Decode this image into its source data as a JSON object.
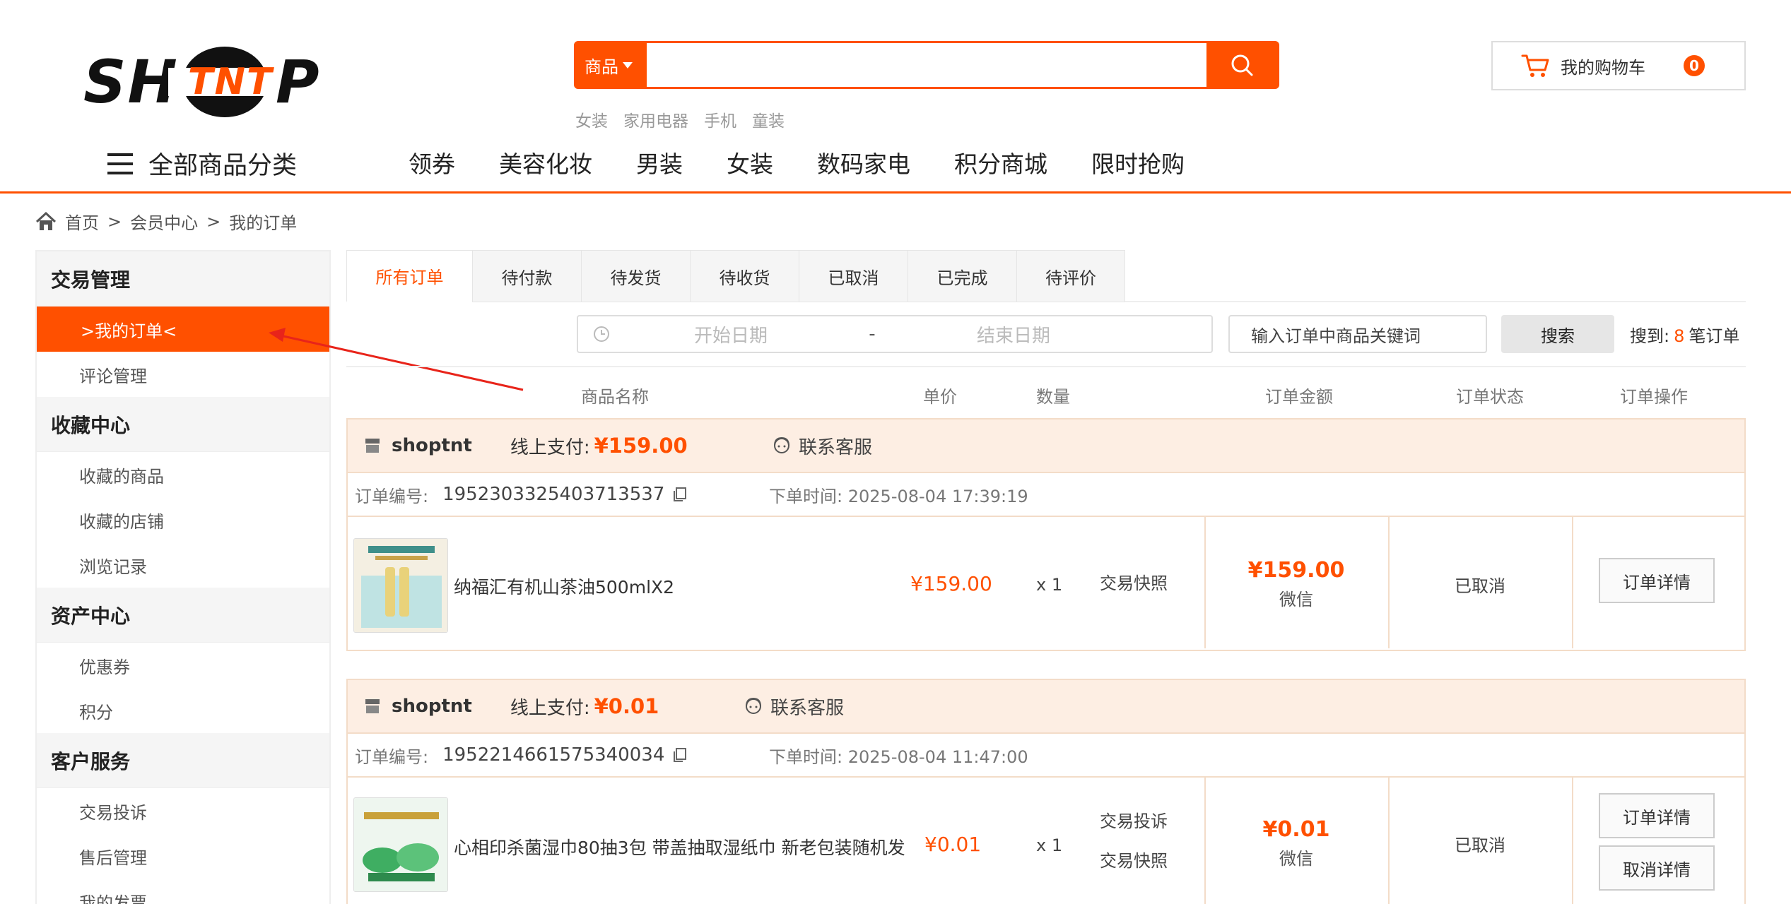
{
  "brand": {
    "logo_left": "SH",
    "logo_mid": "TNT",
    "logo_right": "P"
  },
  "search": {
    "category": "商品",
    "placeholder": "",
    "hot_words": [
      "女装",
      "家用电器",
      "手机",
      "童装"
    ]
  },
  "cart": {
    "label": "我的购物车",
    "count": "0"
  },
  "nav": {
    "all_label": "全部商品分类",
    "items": [
      "领券",
      "美容化妆",
      "男装",
      "女装",
      "数码家电",
      "积分商城",
      "限时抢购"
    ]
  },
  "breadcrumb": {
    "home": "首页",
    "sep": ">",
    "level1": "会员中心",
    "level2": "我的订单"
  },
  "sidebar": {
    "groups": [
      {
        "title": "交易管理",
        "items": [
          ">我的订单<",
          "评论管理"
        ]
      },
      {
        "title": "收藏中心",
        "items": [
          "收藏的商品",
          "收藏的店铺",
          "浏览记录"
        ]
      },
      {
        "title": "资产中心",
        "items": [
          "优惠券",
          "积分"
        ]
      },
      {
        "title": "客户服务",
        "items": [
          "交易投诉",
          "售后管理",
          "我的发票"
        ]
      }
    ]
  },
  "tabs": [
    "所有订单",
    "待付款",
    "待发货",
    "待收货",
    "已取消",
    "已完成",
    "待评价"
  ],
  "filter": {
    "start_date": "开始日期",
    "dash": "-",
    "end_date": "结束日期",
    "keyword_placeholder": "输入订单中商品关键词",
    "search_label": "搜索",
    "found_prefix": "搜到:",
    "found_count": "8",
    "found_suffix": "笔订单"
  },
  "table_headers": [
    "商品名称",
    "单价",
    "数量",
    "订单金额",
    "订单状态",
    "订单操作"
  ],
  "orders": [
    {
      "shop": "shoptnt",
      "pay_label": "线上支付:",
      "pay_amount": "¥159.00",
      "service": "联系客服",
      "no_label": "订单编号:",
      "no": "1952303325403713537",
      "time_label": "下单时间:",
      "time": "2025-08-04 17:39:19",
      "product": "纳福汇有机山茶油500mlX2",
      "price": "¥159.00",
      "qty": "x 1",
      "links": [
        "交易快照"
      ],
      "amount": "¥159.00",
      "method": "微信",
      "status": "已取消",
      "ops": [
        "订单详情"
      ]
    },
    {
      "shop": "shoptnt",
      "pay_label": "线上支付:",
      "pay_amount": "¥0.01",
      "service": "联系客服",
      "no_label": "订单编号:",
      "no": "1952214661575340034",
      "time_label": "下单时间:",
      "time": "2025-08-04 11:47:00",
      "product": "心相印杀菌湿巾80抽3包 带盖抽取湿纸巾 新老包装随机发",
      "price": "¥0.01",
      "qty": "x 1",
      "links": [
        "交易投诉",
        "交易快照"
      ],
      "amount": "¥0.01",
      "method": "微信",
      "status": "已取消",
      "ops": [
        "订单详情",
        "取消详情"
      ]
    }
  ],
  "colors": {
    "accent": "#ff5000",
    "order_head_bg": "#fdeee3"
  }
}
